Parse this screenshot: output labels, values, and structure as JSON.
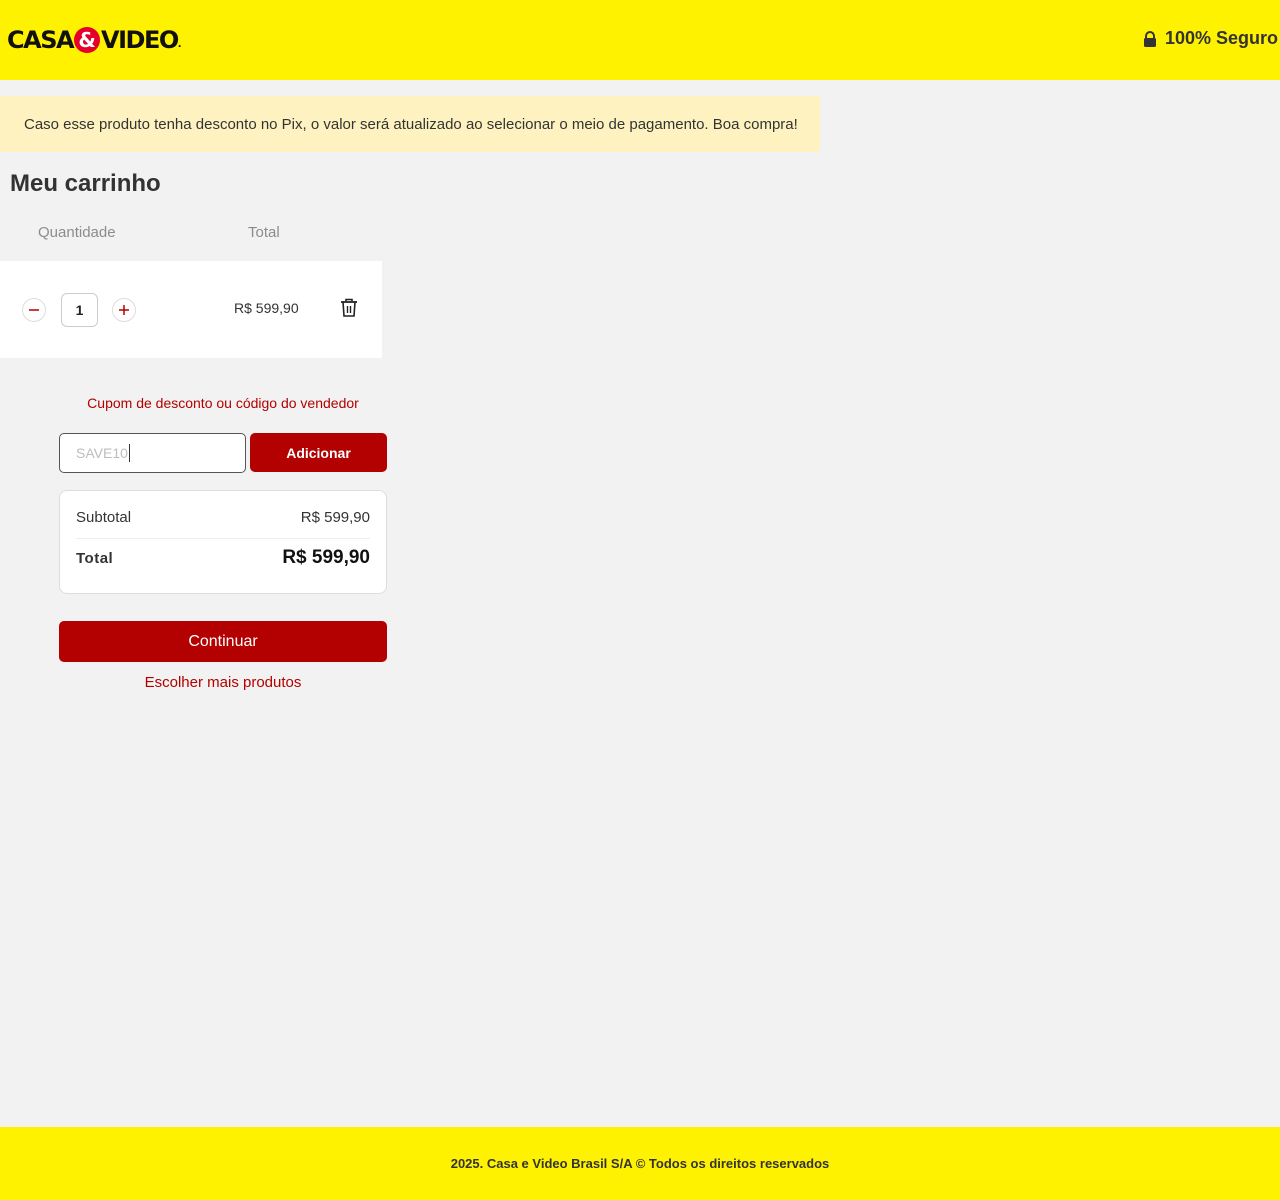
{
  "header": {
    "logo": {
      "left": "CASA",
      "amp": "&",
      "right": "VIDEO",
      "dot": "."
    },
    "secure_label": "100% Seguro"
  },
  "notice": "Caso esse produto tenha desconto no Pix, o valor será atualizado ao selecionar o meio de pagamento. Boa compra!",
  "cart": {
    "title": "Meu carrinho",
    "columns": {
      "quantity": "Quantidade",
      "total": "Total"
    },
    "items": [
      {
        "quantity": "1",
        "total": "R$ 599,90"
      }
    ]
  },
  "coupon": {
    "label": "Cupom de desconto ou código do vendedor",
    "value": "SAVE10",
    "button": "Adicionar"
  },
  "summary": {
    "subtotal_label": "Subtotal",
    "subtotal_value": "R$ 599,90",
    "total_label": "Total",
    "total_value": "R$ 599,90"
  },
  "actions": {
    "continue": "Continuar",
    "more_products": "Escolher mais produtos"
  },
  "footer": "2025. Casa e Video Brasil S/A © Todos os direitos reservados",
  "colors": {
    "brand_yellow": "#fff200",
    "brand_red": "#b30000",
    "notice_bg": "#fef3c0"
  },
  "icons": [
    "lock-icon",
    "minus-icon",
    "plus-icon",
    "trash-icon"
  ]
}
